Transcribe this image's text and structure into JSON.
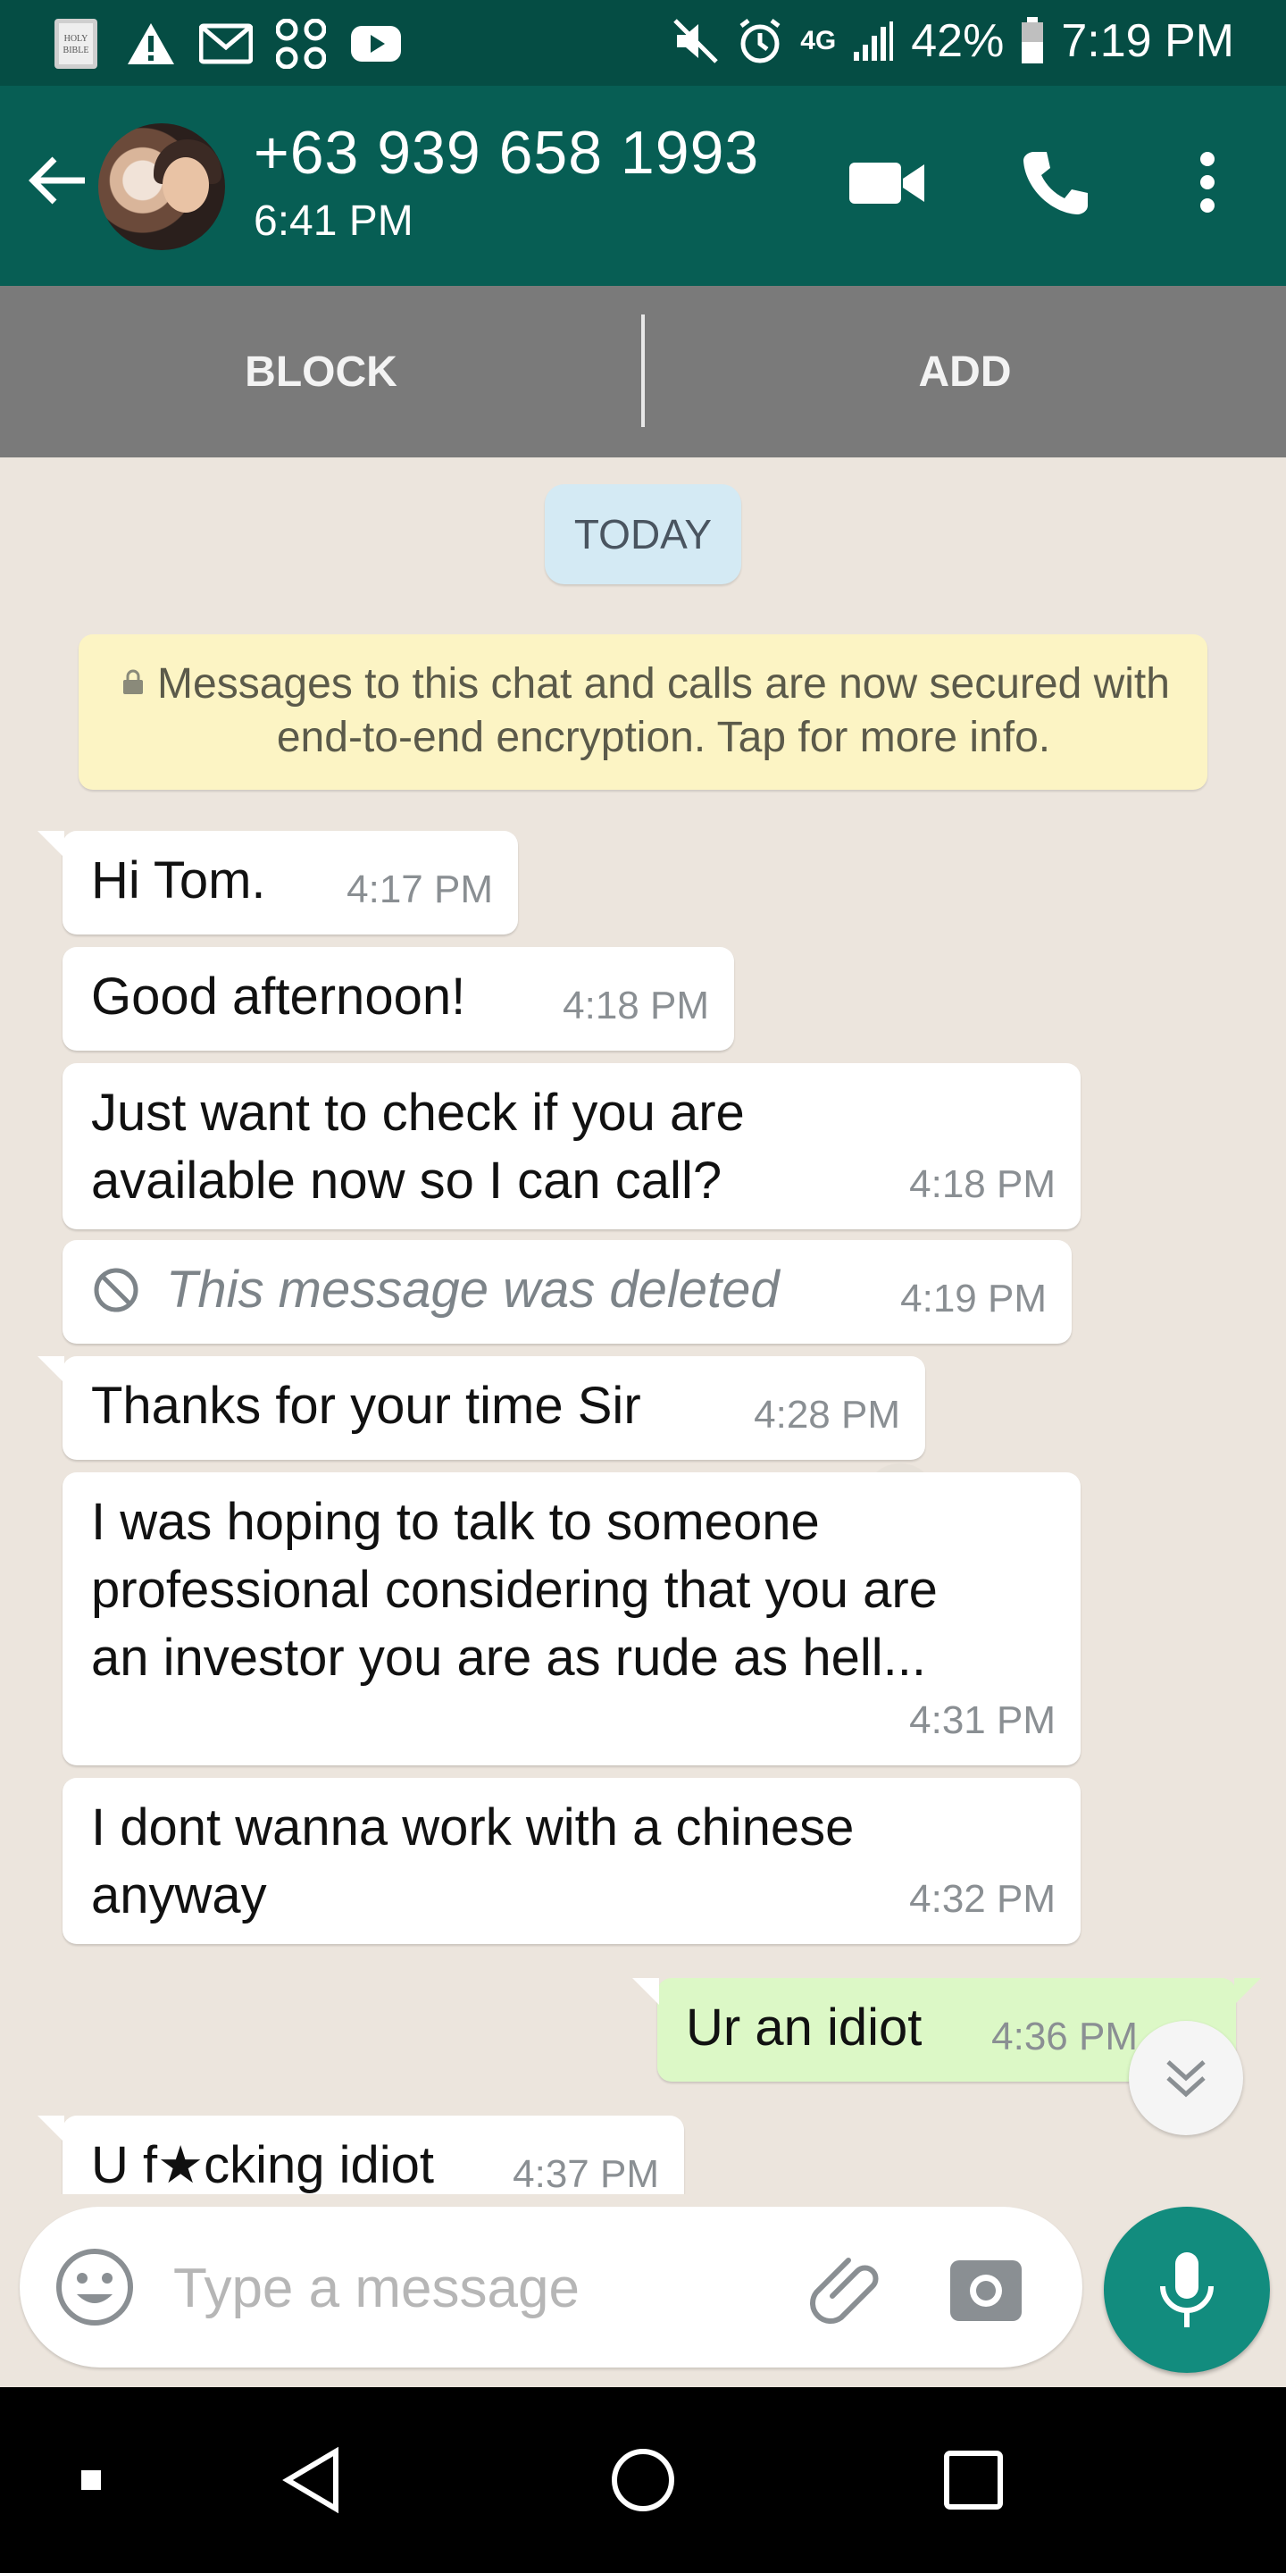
{
  "status_bar": {
    "network": "4G",
    "battery": "42%",
    "time": "7:19 PM",
    "icons": [
      "holy-bible-icon",
      "warning-icon",
      "gmail-icon",
      "app-icon",
      "youtube-icon",
      "mute-icon",
      "alarm-icon",
      "signal-icon",
      "battery-icon"
    ]
  },
  "header": {
    "contact": "+63 939 658 1993",
    "last_seen": "6:41 PM"
  },
  "actions": {
    "block": "BLOCK",
    "add": "ADD"
  },
  "chat": {
    "date": "TODAY",
    "encryption_notice": "Messages to this chat and calls are now secured with end-to-end encryption. Tap for more info.",
    "messages": [
      {
        "text": "Hi Tom.",
        "time": "4:17 PM"
      },
      {
        "text": "Good afternoon!",
        "time": "4:18 PM"
      },
      {
        "text_line1": "Just want to check if you are",
        "text_line2": "available now so I can call?",
        "time": "4:18 PM"
      },
      {
        "text": "This message was deleted",
        "time": "4:19 PM"
      },
      {
        "text": "Thanks for your time Sir",
        "time": "4:28 PM"
      },
      {
        "text_line1": "I was hoping to talk to someone",
        "text_line2": "professional considering that you are",
        "text_line3": "an investor you are as rude as hell...",
        "time": "4:31 PM"
      },
      {
        "text_line1": "I dont wanna work with a chinese",
        "text_line2": "anyway",
        "time": "4:32 PM"
      },
      {
        "text": "Ur an idiot",
        "time": "4:36 PM"
      },
      {
        "text": "U f★cking idiot",
        "time": "4:37 PM"
      }
    ]
  },
  "composer": {
    "placeholder": "Type a message"
  },
  "colors": {
    "header": "#075e54",
    "status_bar": "#054d44",
    "incoming": "#ffffff",
    "outgoing": "#dcf8c6",
    "mic": "#128c7e"
  }
}
